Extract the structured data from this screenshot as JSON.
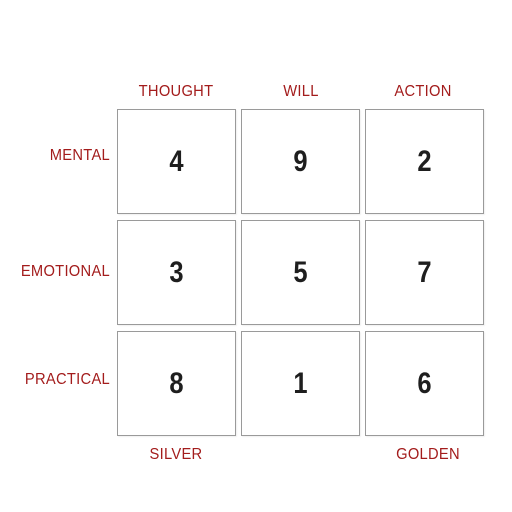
{
  "columns": [
    "THOUGHT",
    "WILL",
    "ACTION"
  ],
  "rows": [
    "MENTAL",
    "EMOTIONAL",
    "PRACTICAL"
  ],
  "grid": [
    [
      "4",
      "9",
      "2"
    ],
    [
      "3",
      "5",
      "7"
    ],
    [
      "8",
      "1",
      "6"
    ]
  ],
  "bottom_labels": {
    "left": "SILVER",
    "right": "GOLDEN"
  },
  "colors": {
    "label": "#a31c1c",
    "number": "#1e1e1e",
    "border": "#9a9a9a"
  }
}
